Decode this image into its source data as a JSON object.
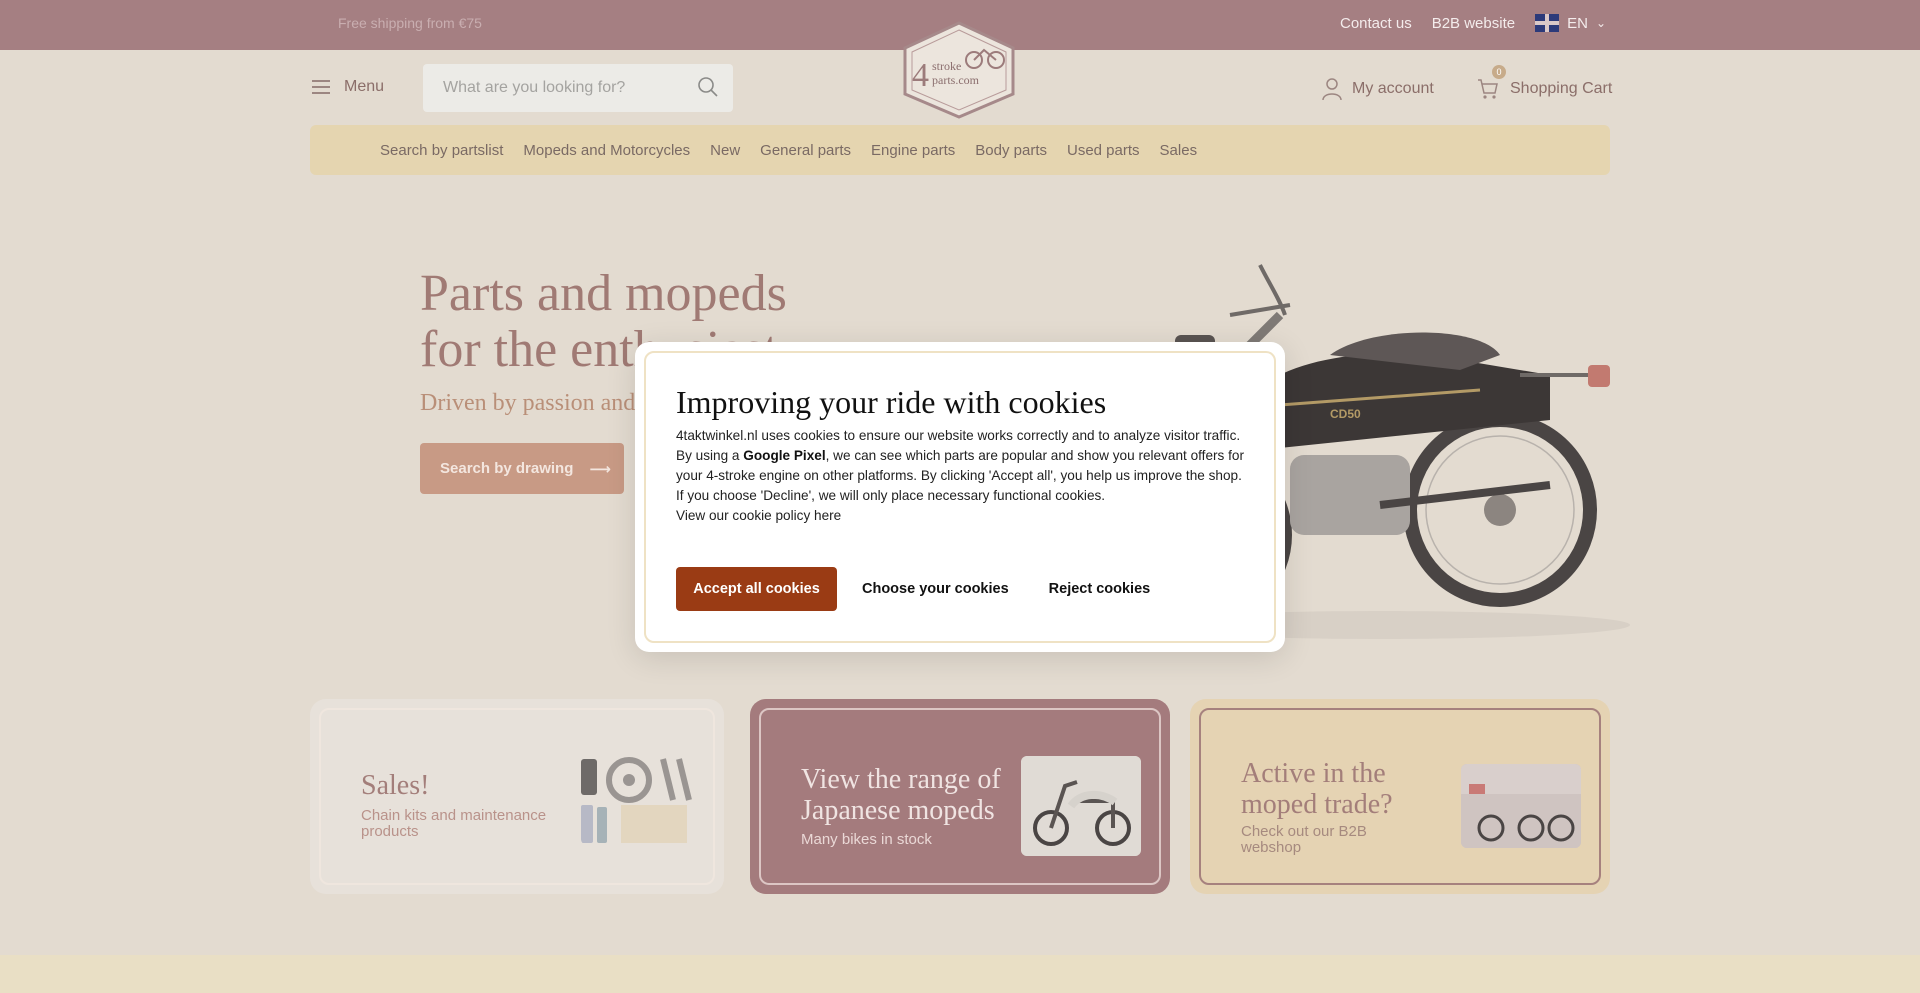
{
  "topbar": {
    "free_shipping": "Free shipping from €75",
    "contact": "Contact us",
    "b2b": "B2B website",
    "language": "EN"
  },
  "header": {
    "menu_label": "Menu",
    "search_placeholder": "What are you looking for?",
    "logo_text_top": "stroke",
    "logo_text_bottom": "parts.com",
    "logo_number": "4",
    "account_label": "My account",
    "cart_label": "Shopping Cart",
    "cart_count": "0"
  },
  "nav": {
    "items": [
      "Search by partslist",
      "Mopeds and Motorcycles",
      "New",
      "General parts",
      "Engine parts",
      "Body parts",
      "Used parts",
      "Sales"
    ]
  },
  "hero": {
    "title_line1": "Parts and mopeds",
    "title_line2": "for the enthusiast",
    "subtitle": "Driven by passion and",
    "button_label": "Search by drawing",
    "bike_badge": "CD50"
  },
  "cards": [
    {
      "title": "Sales!",
      "text": "Chain kits and maintenance products"
    },
    {
      "title": "View the range of Japanese mopeds",
      "text": "Many bikes in stock"
    },
    {
      "title": "Active in the moped trade?",
      "text": "Check out our B2B webshop"
    }
  ],
  "cookie": {
    "title": "Improving your ride with cookies",
    "text_part1": "4taktwinkel.nl uses cookies to ensure our website works correctly and to analyze visitor traffic. By using a ",
    "text_bold": "Google Pixel",
    "text_part2": ", we can see which parts are popular and show you relevant offers for your 4-stroke engine on other platforms. By clicking 'Accept all', you help us improve the shop. If you choose 'Decline', we will only place necessary functional cookies.",
    "policy_link": "View our cookie policy here",
    "accept": "Accept all cookies",
    "choose": "Choose your cookies",
    "reject": "Reject cookies"
  },
  "colors": {
    "topbar": "#a57f82",
    "accept_button": "#9a3b14",
    "nav_bg": "#e5d5b0"
  }
}
